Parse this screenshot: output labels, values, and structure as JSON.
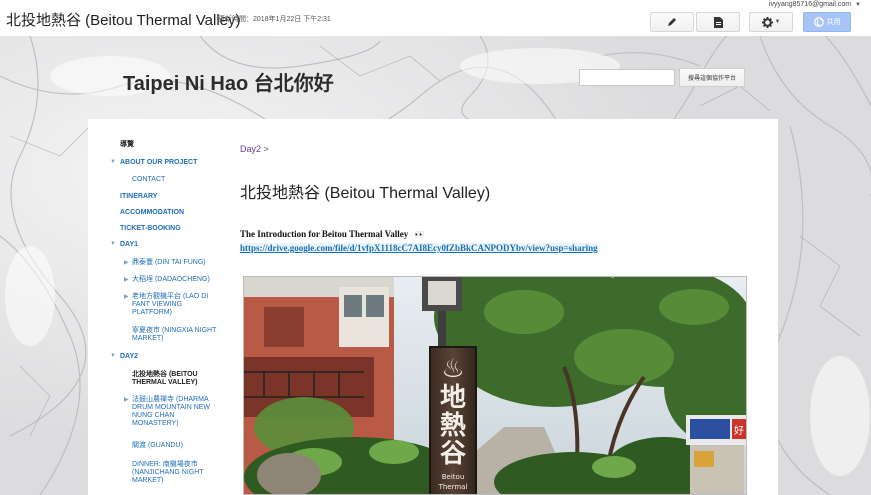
{
  "editor": {
    "doc_title": "北投地熱谷 (Beitou Thermal Valley)",
    "updated": "更新時間：2018年1月22日 下午2:31",
    "user_email": "ivyyang85716@gmail.com",
    "share_label": "共用"
  },
  "site": {
    "title": "Taipei Ni Hao 台北你好",
    "search": {
      "value": "",
      "button_label": "搜尋這個協作平台"
    }
  },
  "sidebar": {
    "heading": "導覽",
    "items": [
      {
        "label": "ABOUT OUR PROJECT"
      },
      {
        "label": "CONTACT"
      },
      {
        "label": "ITINERARY"
      },
      {
        "label": "ACCOMMODATION"
      },
      {
        "label": "TICKET-BOOKING"
      },
      {
        "label": "DAY1"
      },
      {
        "label": "鼎泰豐 (DIN TAI FUNG)"
      },
      {
        "label": "大稻埕 (DADAOCHENG)"
      },
      {
        "label": "老地方觀機平台 (LAO DI FANT VIEWING PLATFORM)"
      },
      {
        "label": "寧夏夜市 (NINGXIA NIGHT MARKET)"
      },
      {
        "label": "DAY2"
      },
      {
        "label": "北投地熱谷 (BEITOU THERMAL VALLEY)"
      },
      {
        "label": "法鼓山農禪寺 (DHARMA DRUM MOUNTAIN NEW NUNG CHAN MONASTERY)"
      },
      {
        "label": "關渡 (GUANDU)"
      },
      {
        "label": "DINNER: 南機場夜市 (NANJICHANG NIGHT MARKET)"
      }
    ]
  },
  "content": {
    "breadcrumb": {
      "parent": "Day2",
      "separator": ">"
    },
    "heading": "北投地熱谷 (Beitou Thermal Valley)",
    "intro": "The  Introduction for Beitou  Thermal Valley",
    "intro_emoji": "👀",
    "link": "https://drive.google.com/file/d/1vfpX1118cC7AI8Ecy0fZbBkCANPODYbv/view?usp=sharing",
    "photo": {
      "sign_symbol": "♨",
      "sign_text": "地熱谷",
      "sign_caption_1": "Beitou",
      "sign_caption_2": "Thermal",
      "stall_text": "好"
    }
  }
}
